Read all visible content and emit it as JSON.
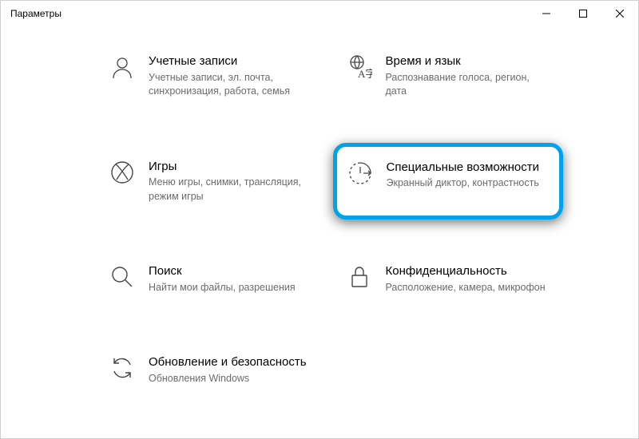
{
  "window": {
    "title": "Параметры"
  },
  "tiles": {
    "accounts": {
      "title": "Учетные записи",
      "desc": "Учетные записи, эл. почта, синхронизация, работа, семья"
    },
    "time_lang": {
      "title": "Время и язык",
      "desc": "Распознавание голоса, регион, дата"
    },
    "gaming": {
      "title": "Игры",
      "desc": "Меню игры, снимки, трансляция, режим игры"
    },
    "ease": {
      "title": "Специальные возможности",
      "desc": "Экранный диктор, контрастность"
    },
    "search": {
      "title": "Поиск",
      "desc": "Найти мои файлы, разрешения"
    },
    "privacy": {
      "title": "Конфиденциальность",
      "desc": "Расположение, камера, микрофон"
    },
    "update": {
      "title": "Обновление и безопасность",
      "desc": "Обновления Windows"
    }
  }
}
